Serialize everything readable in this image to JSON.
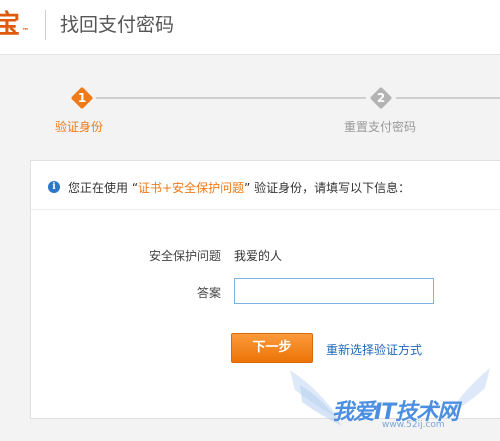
{
  "header": {
    "logo_text": "宝",
    "logo_tm": "™",
    "title": "找回支付密码"
  },
  "steps": [
    {
      "number": "1",
      "label": "验证身份",
      "state": "active"
    },
    {
      "number": "2",
      "label": "重置支付密码",
      "state": "pending"
    }
  ],
  "notice": {
    "icon": "info-icon",
    "icon_glyph": "i",
    "prefix": "您正在使用 “",
    "highlight": "证书+安全保护问题",
    "suffix": "” 验证身份，请填写以下信息："
  },
  "form": {
    "question_label": "安全保护问题",
    "question_value": "我爱的人",
    "answer_label": "答案",
    "answer_value": ""
  },
  "actions": {
    "next_label": "下一步",
    "alt_link": "重新选择验证方式"
  },
  "watermark": {
    "text": "我爱IT技术网",
    "url": "www.52ij.com"
  },
  "colors": {
    "accent": "#f07a17",
    "link": "#1f67b8",
    "info": "#2b78c8",
    "inactive": "#b3b3b3"
  }
}
